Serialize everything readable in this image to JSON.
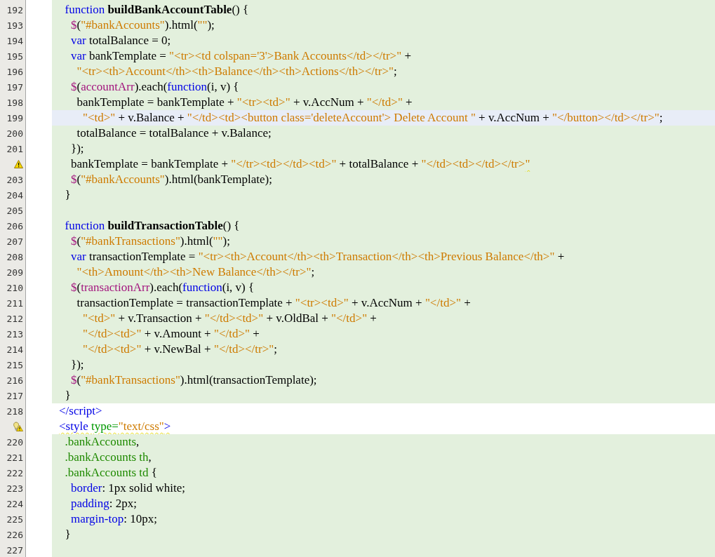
{
  "editor": {
    "lines": [
      {
        "number": "192",
        "embedded": true,
        "current": false,
        "tokens": [
          {
            "kind": "keyword",
            "text": "  function "
          },
          {
            "kind": "function_name",
            "text": "buildBankAccountTable"
          },
          {
            "kind": "plain",
            "text": "() {"
          }
        ]
      },
      {
        "number": "193",
        "embedded": true,
        "current": false,
        "tokens": [
          {
            "kind": "jquery",
            "text": "    $"
          },
          {
            "kind": "plain",
            "text": "("
          },
          {
            "kind": "string",
            "text": "\"#bankAccounts\""
          },
          {
            "kind": "plain",
            "text": ").html("
          },
          {
            "kind": "string",
            "text": "\"\""
          },
          {
            "kind": "plain",
            "text": ");"
          }
        ]
      },
      {
        "number": "194",
        "embedded": true,
        "current": false,
        "tokens": [
          {
            "kind": "keyword",
            "text": "    var"
          },
          {
            "kind": "plain",
            "text": " totalBalance = 0;"
          }
        ]
      },
      {
        "number": "195",
        "embedded": true,
        "current": false,
        "tokens": [
          {
            "kind": "keyword",
            "text": "    var"
          },
          {
            "kind": "plain",
            "text": " bankTemplate = "
          },
          {
            "kind": "string",
            "text": "\"<tr><td colspan='3'>Bank Accounts</td></tr>\""
          },
          {
            "kind": "plain",
            "text": " +"
          }
        ]
      },
      {
        "number": "196",
        "embedded": true,
        "current": false,
        "tokens": [
          {
            "kind": "string",
            "text": "      \"<tr><th>Account</th><th>Balance</th><th>Actions</th></tr>\""
          },
          {
            "kind": "plain",
            "text": ";"
          }
        ]
      },
      {
        "number": "197",
        "embedded": true,
        "current": false,
        "tokens": [
          {
            "kind": "jquery",
            "text": "    $"
          },
          {
            "kind": "plain",
            "text": "("
          },
          {
            "kind": "jquery",
            "text": "accountArr"
          },
          {
            "kind": "plain",
            "text": ").each("
          },
          {
            "kind": "keyword",
            "text": "function"
          },
          {
            "kind": "plain",
            "text": "(i, v) {"
          }
        ]
      },
      {
        "number": "198",
        "embedded": true,
        "current": false,
        "tokens": [
          {
            "kind": "plain",
            "text": "      bankTemplate = bankTemplate + "
          },
          {
            "kind": "string",
            "text": "\"<tr><td>\""
          },
          {
            "kind": "plain",
            "text": " + v.AccNum + "
          },
          {
            "kind": "string",
            "text": "\"</td>\""
          },
          {
            "kind": "plain",
            "text": " +"
          }
        ]
      },
      {
        "number": "199",
        "embedded": true,
        "current": true,
        "tokens": [
          {
            "kind": "string",
            "text": "        \"<td>\""
          },
          {
            "kind": "plain",
            "text": " + v.Balance + "
          },
          {
            "kind": "string",
            "text": "\"</td><td><button class='deleteAccount'> Delete Account \""
          },
          {
            "kind": "plain",
            "text": " + v.AccNum + "
          },
          {
            "kind": "string",
            "text": "\"</button></td></tr>\""
          },
          {
            "kind": "plain",
            "text": ";"
          }
        ]
      },
      {
        "number": "200",
        "embedded": true,
        "current": false,
        "tokens": [
          {
            "kind": "plain",
            "text": "      totalBalance = totalBalance + v.Balance;"
          }
        ]
      },
      {
        "number": "201",
        "embedded": true,
        "current": false,
        "tokens": [
          {
            "kind": "plain",
            "text": "    });"
          }
        ]
      },
      {
        "kind": "warning",
        "embedded": true,
        "current": false,
        "tokens": [
          {
            "kind": "plain",
            "text": "    bankTemplate = bankTemplate + "
          },
          {
            "kind": "string",
            "text": "\"</tr><td></td><td>\""
          },
          {
            "kind": "plain",
            "text": " + totalBalance + "
          },
          {
            "kind": "string",
            "text": "\"</td><td></td></tr>"
          },
          {
            "kind": "string",
            "text": "\"",
            "squiggle": true
          }
        ]
      },
      {
        "number": "203",
        "embedded": true,
        "current": false,
        "tokens": [
          {
            "kind": "jquery",
            "text": "    $"
          },
          {
            "kind": "plain",
            "text": "("
          },
          {
            "kind": "string",
            "text": "\"#bankAccounts\""
          },
          {
            "kind": "plain",
            "text": ").html(bankTemplate);"
          }
        ]
      },
      {
        "number": "204",
        "embedded": true,
        "current": false,
        "tokens": [
          {
            "kind": "plain",
            "text": "  }"
          }
        ]
      },
      {
        "number": "205",
        "embedded": true,
        "current": false
      },
      {
        "number": "206",
        "embedded": true,
        "current": false,
        "tokens": [
          {
            "kind": "keyword",
            "text": "  function "
          },
          {
            "kind": "function_name",
            "text": "buildTransactionTable"
          },
          {
            "kind": "plain",
            "text": "() {"
          }
        ]
      },
      {
        "number": "207",
        "embedded": true,
        "current": false,
        "tokens": [
          {
            "kind": "jquery",
            "text": "    $"
          },
          {
            "kind": "plain",
            "text": "("
          },
          {
            "kind": "string",
            "text": "\"#bankTransactions\""
          },
          {
            "kind": "plain",
            "text": ").html("
          },
          {
            "kind": "string",
            "text": "\"\""
          },
          {
            "kind": "plain",
            "text": ");"
          }
        ]
      },
      {
        "number": "208",
        "embedded": true,
        "current": false,
        "tokens": [
          {
            "kind": "keyword",
            "text": "    var"
          },
          {
            "kind": "plain",
            "text": " transactionTemplate = "
          },
          {
            "kind": "string",
            "text": "\"<tr><th>Account</th><th>Transaction</th><th>Previous Balance</th>\""
          },
          {
            "kind": "plain",
            "text": " +"
          }
        ]
      },
      {
        "number": "209",
        "embedded": true,
        "current": false,
        "tokens": [
          {
            "kind": "string",
            "text": "      \"<th>Amount</th><th>New Balance</th></tr>\""
          },
          {
            "kind": "plain",
            "text": ";"
          }
        ]
      },
      {
        "number": "210",
        "embedded": true,
        "current": false,
        "tokens": [
          {
            "kind": "jquery",
            "text": "    $"
          },
          {
            "kind": "plain",
            "text": "("
          },
          {
            "kind": "jquery",
            "text": "transactionArr"
          },
          {
            "kind": "plain",
            "text": ").each("
          },
          {
            "kind": "keyword",
            "text": "function"
          },
          {
            "kind": "plain",
            "text": "(i, v) {"
          }
        ]
      },
      {
        "number": "211",
        "embedded": true,
        "current": false,
        "tokens": [
          {
            "kind": "plain",
            "text": "      transactionTemplate = transactionTemplate + "
          },
          {
            "kind": "string",
            "text": "\"<tr><td>\""
          },
          {
            "kind": "plain",
            "text": " + v.AccNum + "
          },
          {
            "kind": "string",
            "text": "\"</td>\""
          },
          {
            "kind": "plain",
            "text": " +"
          }
        ]
      },
      {
        "number": "212",
        "embedded": true,
        "current": false,
        "tokens": [
          {
            "kind": "string",
            "text": "        \"<td>\""
          },
          {
            "kind": "plain",
            "text": " + v.Transaction + "
          },
          {
            "kind": "string",
            "text": "\"</td><td>\""
          },
          {
            "kind": "plain",
            "text": " + v.OldBal + "
          },
          {
            "kind": "string",
            "text": "\"</td>\""
          },
          {
            "kind": "plain",
            "text": " +"
          }
        ]
      },
      {
        "number": "213",
        "embedded": true,
        "current": false,
        "tokens": [
          {
            "kind": "string",
            "text": "        \"</td><td>\""
          },
          {
            "kind": "plain",
            "text": " + v.Amount + "
          },
          {
            "kind": "string",
            "text": "\"</td>\""
          },
          {
            "kind": "plain",
            "text": " +"
          }
        ]
      },
      {
        "number": "214",
        "embedded": true,
        "current": false,
        "tokens": [
          {
            "kind": "string",
            "text": "        \"</td><td>\""
          },
          {
            "kind": "plain",
            "text": " + v.NewBal + "
          },
          {
            "kind": "string",
            "text": "\"</td></tr>\""
          },
          {
            "kind": "plain",
            "text": ";"
          }
        ]
      },
      {
        "number": "215",
        "embedded": true,
        "current": false,
        "tokens": [
          {
            "kind": "plain",
            "text": "    });"
          }
        ]
      },
      {
        "number": "216",
        "embedded": true,
        "current": false,
        "tokens": [
          {
            "kind": "jquery",
            "text": "    $"
          },
          {
            "kind": "plain",
            "text": "("
          },
          {
            "kind": "string",
            "text": "\"#bankTransactions\""
          },
          {
            "kind": "plain",
            "text": ").html(transactionTemplate);"
          }
        ]
      },
      {
        "number": "217",
        "embedded": true,
        "current": false,
        "tokens": [
          {
            "kind": "plain",
            "text": "  }"
          }
        ]
      },
      {
        "number": "218",
        "embedded": false,
        "current": false,
        "tokens": [
          {
            "kind": "tag",
            "text": "</script>"
          }
        ]
      },
      {
        "kind": "hint",
        "embedded": false,
        "current": false,
        "tokens": [
          {
            "kind": "tag",
            "text": "<style ",
            "squiggle": true
          },
          {
            "kind": "attribute",
            "text": "type=",
            "squiggle": true
          },
          {
            "kind": "string",
            "text": "\"text/css\"",
            "squiggle": true
          },
          {
            "kind": "tag",
            "text": ">",
            "squiggle": true
          }
        ]
      },
      {
        "number": "220",
        "embedded": true,
        "current": false,
        "tokens": [
          {
            "kind": "selector",
            "text": "  .bankAccounts"
          },
          {
            "kind": "plain",
            "text": ","
          }
        ]
      },
      {
        "number": "221",
        "embedded": true,
        "current": false,
        "tokens": [
          {
            "kind": "selector",
            "text": "  .bankAccounts th"
          },
          {
            "kind": "plain",
            "text": ","
          }
        ]
      },
      {
        "number": "222",
        "embedded": true,
        "current": false,
        "tokens": [
          {
            "kind": "selector",
            "text": "  .bankAccounts td"
          },
          {
            "kind": "plain",
            "text": " {"
          }
        ]
      },
      {
        "number": "223",
        "embedded": true,
        "current": false,
        "tokens": [
          {
            "kind": "property",
            "text": "    border"
          },
          {
            "kind": "plain",
            "text": ": 1px solid white;"
          }
        ]
      },
      {
        "number": "224",
        "embedded": true,
        "current": false,
        "tokens": [
          {
            "kind": "property",
            "text": "    padding"
          },
          {
            "kind": "plain",
            "text": ": 2px;"
          }
        ]
      },
      {
        "number": "225",
        "embedded": true,
        "current": false,
        "tokens": [
          {
            "kind": "property",
            "text": "    margin-top"
          },
          {
            "kind": "plain",
            "text": ": 10px;"
          }
        ]
      },
      {
        "number": "226",
        "embedded": true,
        "current": false,
        "tokens": [
          {
            "kind": "plain",
            "text": "  }"
          }
        ]
      },
      {
        "number": "227",
        "embedded": true,
        "current": false
      }
    ]
  }
}
